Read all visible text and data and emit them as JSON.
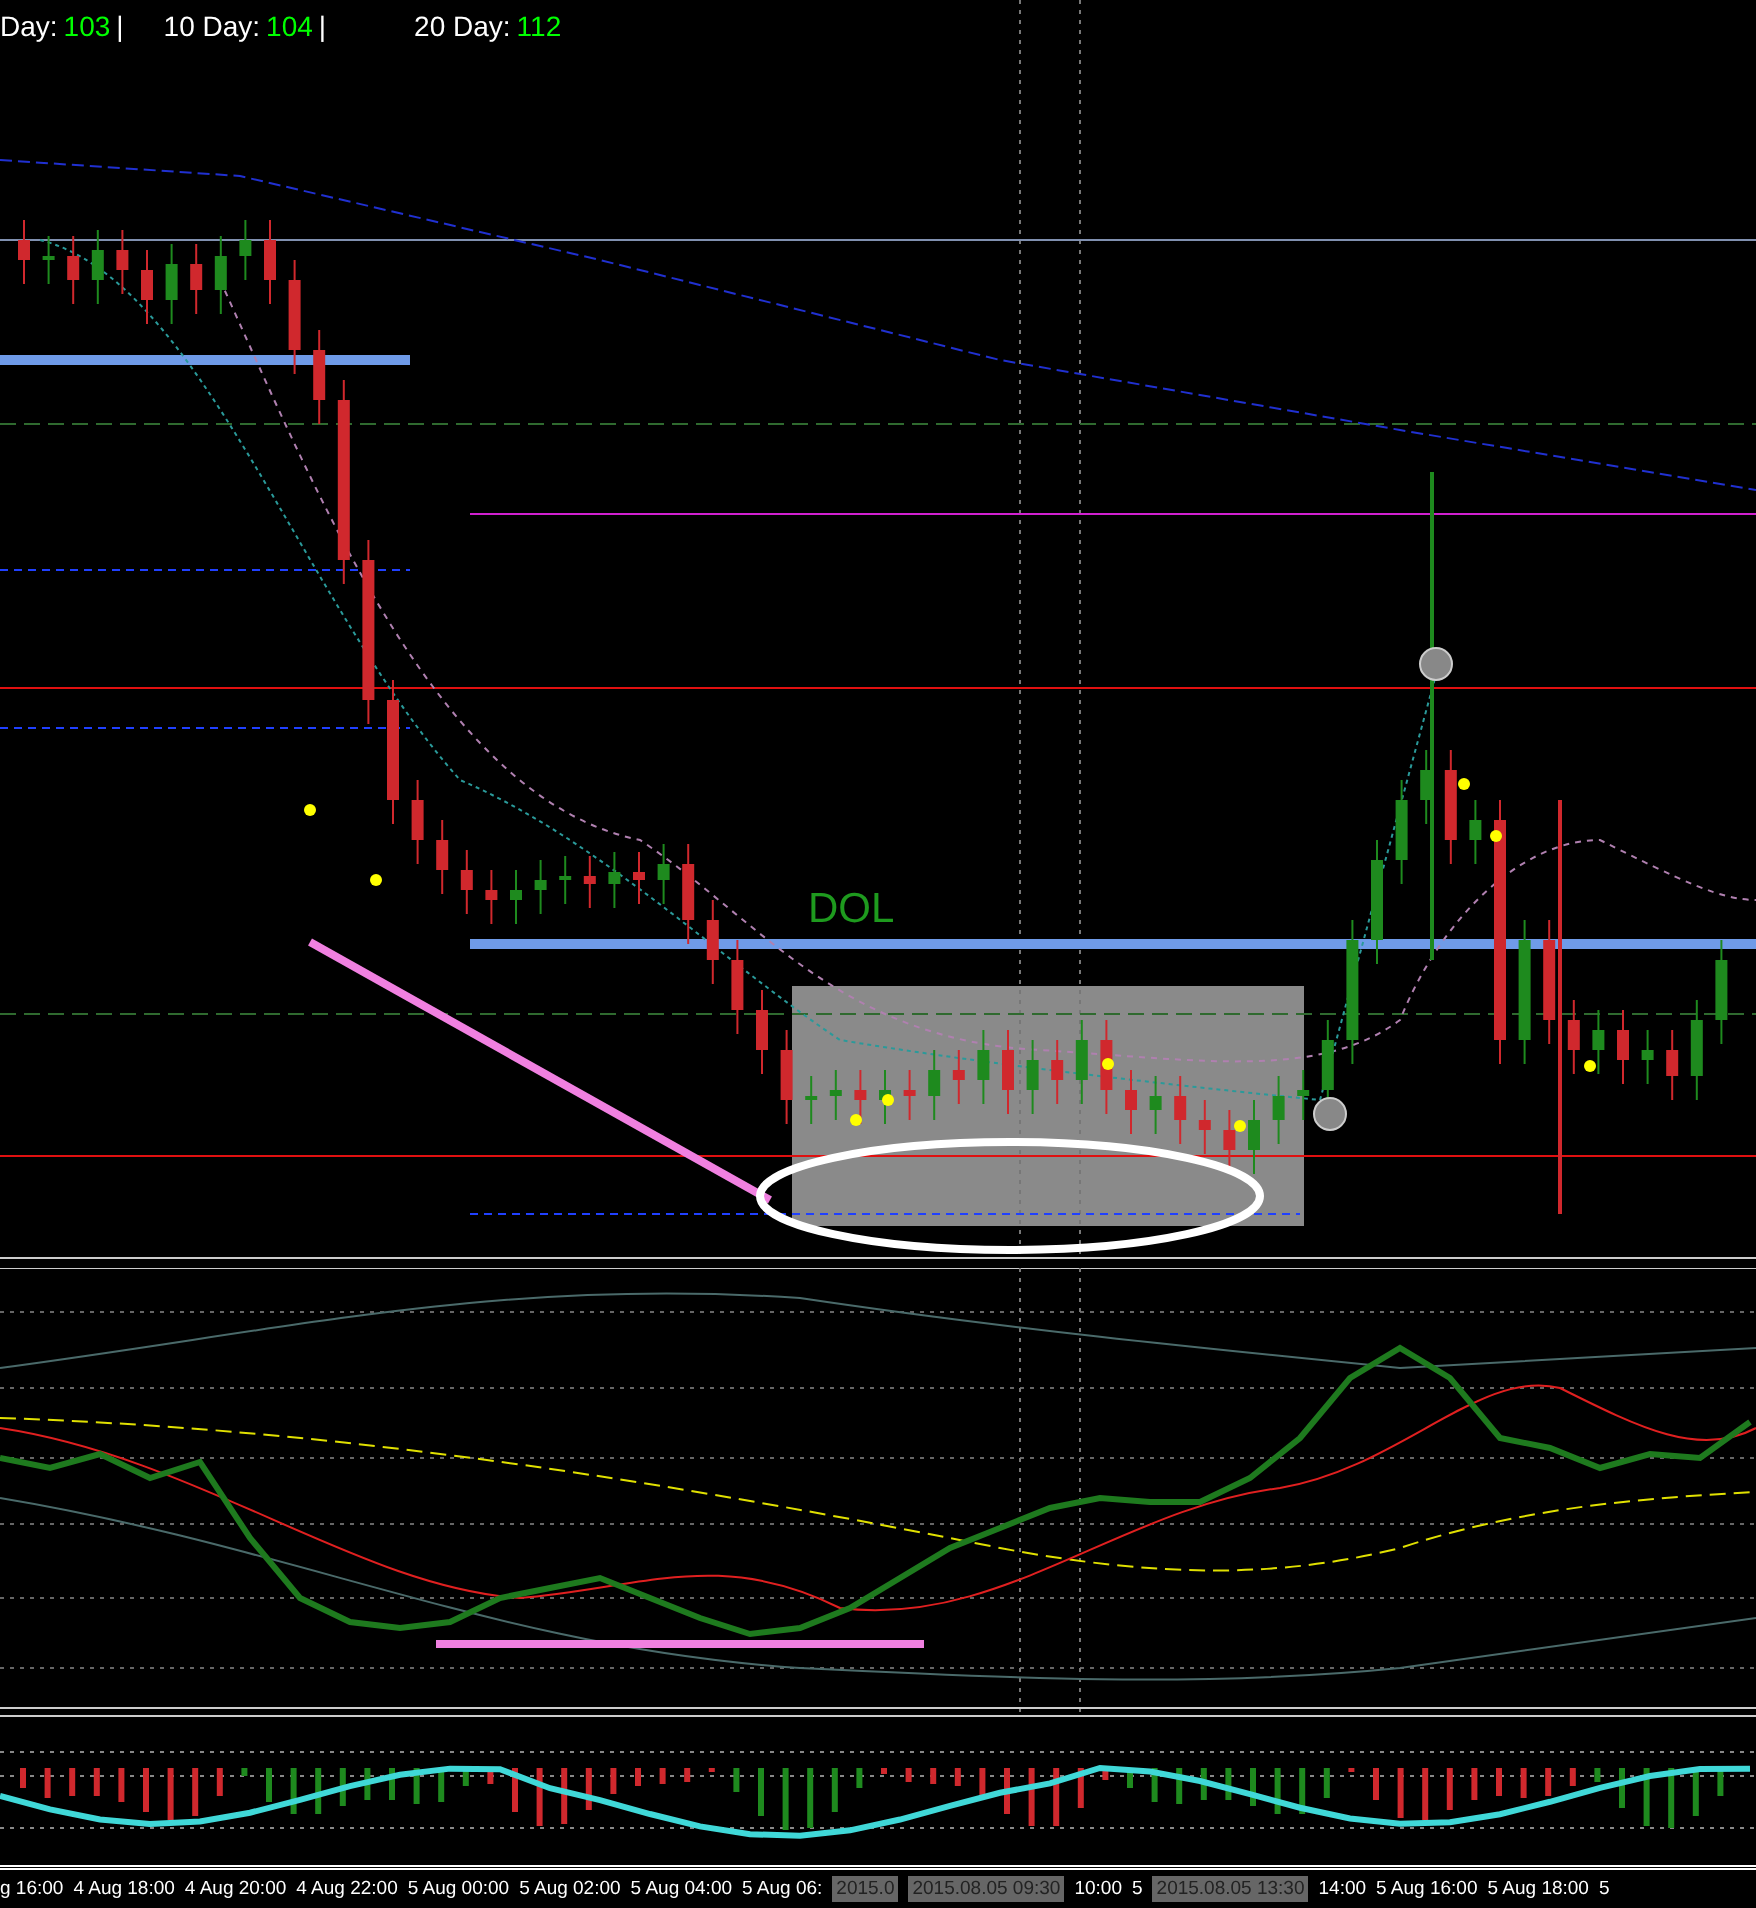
{
  "header": {
    "stats": [
      {
        "label": "Day:",
        "value": "103",
        "trail": "|"
      },
      {
        "label": "10 Day:",
        "value": "104",
        "trail": "|"
      },
      {
        "label": "20 Day:",
        "value": "112"
      }
    ]
  },
  "chart": {
    "annotation": "DOL"
  },
  "time_axis": {
    "labels": [
      {
        "text": "g 16:00",
        "kind": "plain"
      },
      {
        "text": "4 Aug 18:00",
        "kind": "plain"
      },
      {
        "text": "4 Aug 20:00",
        "kind": "plain"
      },
      {
        "text": "4 Aug 22:00",
        "kind": "plain"
      },
      {
        "text": "5 Aug 00:00",
        "kind": "plain"
      },
      {
        "text": "5 Aug 02:00",
        "kind": "plain"
      },
      {
        "text": "5 Aug 04:00",
        "kind": "plain"
      },
      {
        "text": "5 Aug 06:",
        "kind": "plain"
      },
      {
        "text": "2015.0",
        "kind": "highlight"
      },
      {
        "text": "2015.08.05 09:30",
        "kind": "highlight"
      },
      {
        "text": "10:00",
        "kind": "plain"
      },
      {
        "text": "5",
        "kind": "plain"
      },
      {
        "text": "2015.08.05 13:30",
        "kind": "highlight"
      },
      {
        "text": "14:00",
        "kind": "plain"
      },
      {
        "text": "5 Aug 16:00",
        "kind": "plain"
      },
      {
        "text": "5 Aug 18:00",
        "kind": "plain"
      },
      {
        "text": "5",
        "kind": "plain"
      }
    ]
  }
}
